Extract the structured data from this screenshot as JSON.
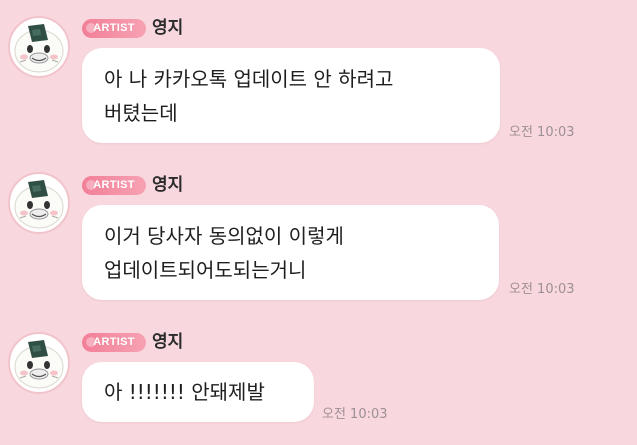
{
  "messages": [
    {
      "badge": "ARTIST",
      "sender": "영지",
      "text": "아 나 카카오톡 업데이트 안 하려고\n버텼는데",
      "time": "오전 10:03",
      "avatar_icon": "rice-ball-character-icon"
    },
    {
      "badge": "ARTIST",
      "sender": "영지",
      "text": "이거 당사자 동의없이 이렇게\n업데이트되어도되는거니",
      "time": "오전 10:03",
      "avatar_icon": "rice-ball-character-icon"
    },
    {
      "badge": "ARTIST",
      "sender": "영지",
      "text": "아 !!!!!!! 안돼제발",
      "time": "오전 10:03",
      "avatar_icon": "rice-ball-character-icon"
    }
  ],
  "colors": {
    "background": "#f8d8de",
    "bubble": "#ffffff",
    "badge": "#f27f97",
    "time_text": "#9d8f93"
  }
}
